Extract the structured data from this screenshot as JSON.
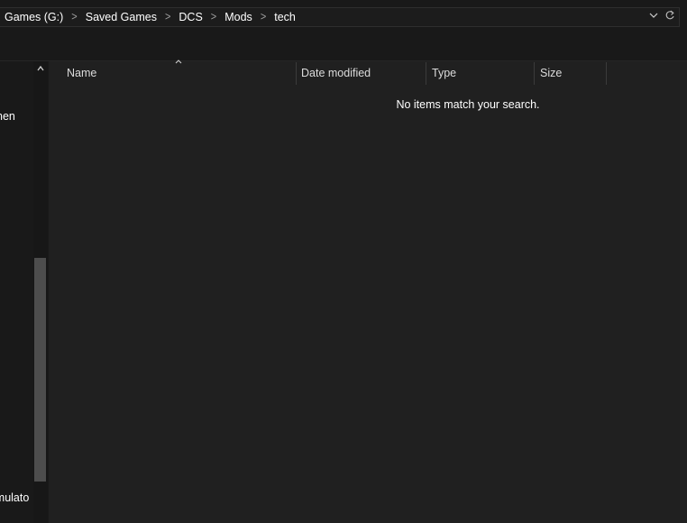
{
  "address_bar": {
    "crumbs": [
      "Games (G:)",
      "Saved Games",
      "DCS",
      "Mods",
      "tech"
    ],
    "separator": ">",
    "dropdown_icon": "chevron-down-icon",
    "refresh_icon": "refresh-icon"
  },
  "nav_pane": {
    "items": [
      {
        "label": "nen"
      },
      {
        "label": "imulato"
      }
    ]
  },
  "columns": [
    {
      "label": "Name"
    },
    {
      "label": "Date modified"
    },
    {
      "label": "Type"
    },
    {
      "label": "Size"
    }
  ],
  "content": {
    "empty_message": "No items match your search."
  },
  "colors": {
    "background": "#191919",
    "content_background": "#202020",
    "scroll_thumb": "#4d4d4d"
  }
}
